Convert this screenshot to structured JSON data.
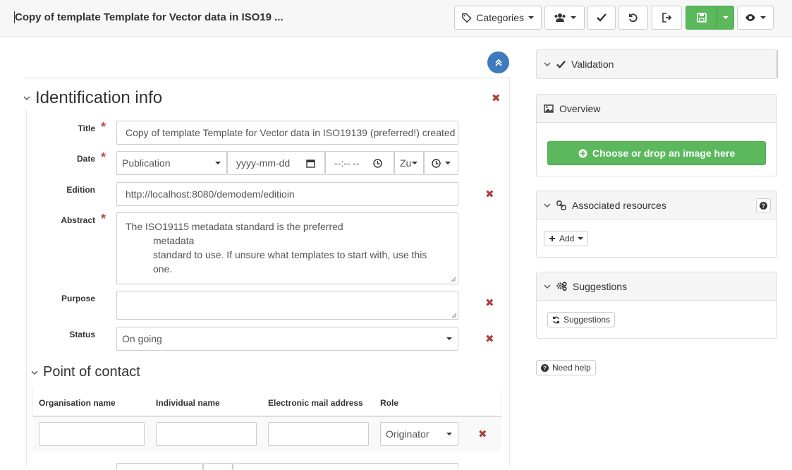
{
  "header": {
    "title": "Copy of template Template for Vector data in ISO19 ...",
    "categories_label": "Categories"
  },
  "identification": {
    "section_title": "Identification info",
    "title_label": "Title",
    "title_value": "Copy of template Template for Vector data in ISO19139 (preferred!) created",
    "date_label": "Date",
    "date_type": "Publication",
    "date_placeholder": "yyyy-mm-dd",
    "time_placeholder": "--:-- --",
    "timezone_value": "Zu",
    "edition_label": "Edition",
    "edition_value": "http://localhost:8080/demodem/editioin",
    "abstract_label": "Abstract",
    "abstract_lines": [
      "The ISO19115 metadata standard is the preferred",
      "metadata",
      "standard to use. If unsure what templates to start with, use this",
      "one."
    ],
    "purpose_label": "Purpose",
    "purpose_value": "",
    "status_label": "Status",
    "status_value": "On going"
  },
  "contact": {
    "section_title": "Point of contact",
    "columns": [
      "Organisation name",
      "Individual name",
      "Electronic mail address",
      "Role"
    ],
    "row": {
      "organisation": "",
      "individual": "",
      "email": "",
      "role": "Originator"
    }
  },
  "sidebar": {
    "validation_title": "Validation",
    "overview_title": "Overview",
    "overview_button": "Choose or drop an image here",
    "associated_title": "Associated resources",
    "add_label": "Add",
    "suggestions_title": "Suggestions",
    "suggestions_button": "Suggestions",
    "need_help": "Need help"
  },
  "colors": {
    "primary_green": "#5cb85c",
    "collapse_blue": "#3f79be",
    "remove_red": "#a94442",
    "required_red": "#b94a48"
  }
}
